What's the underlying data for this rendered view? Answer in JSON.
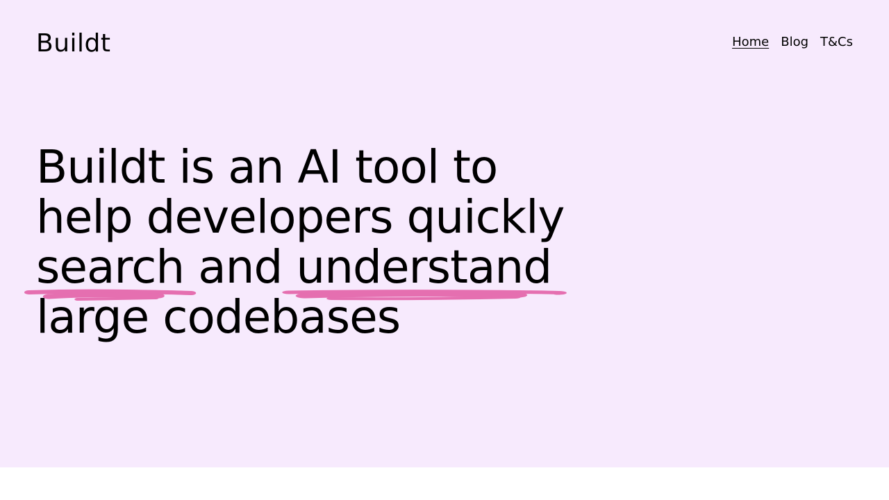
{
  "header": {
    "brand": "Buildt",
    "nav": [
      {
        "label": "Home",
        "active": true
      },
      {
        "label": "Blog",
        "active": false
      },
      {
        "label": "T&Cs",
        "active": false
      }
    ]
  },
  "hero": {
    "line1": "Buildt is an AI tool to",
    "line2": "help developers quickly",
    "line3_hl1": "search",
    "line3_mid": " and ",
    "line3_hl2": "understand",
    "line4": "large codebases"
  },
  "colors": {
    "hero_background": "#f7eafd",
    "highlight": "#e56fb0",
    "text": "#000000"
  }
}
